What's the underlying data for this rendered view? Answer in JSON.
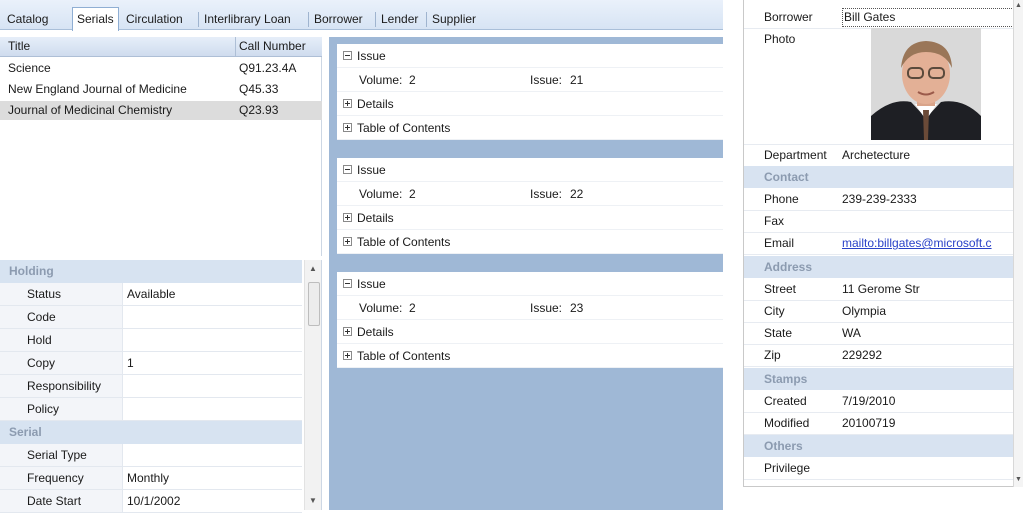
{
  "tabs": [
    {
      "label": "Catalog",
      "active": false
    },
    {
      "label": "Serials",
      "active": true
    },
    {
      "label": "Circulation",
      "active": false
    },
    {
      "label": "Interlibrary Loan",
      "active": false
    },
    {
      "label": "Borrower",
      "active": false
    },
    {
      "label": "Lender",
      "active": false
    },
    {
      "label": "Supplier",
      "active": false
    }
  ],
  "titles": {
    "headers": {
      "title": "Title",
      "call_number": "Call Number"
    },
    "rows": [
      {
        "title": "Science",
        "call_number": "Q91.23.4A"
      },
      {
        "title": "New England Journal of Medicine",
        "call_number": "Q45.33"
      },
      {
        "title": "Journal of Medicinal Chemistry",
        "call_number": "Q23.93",
        "selected": true
      }
    ]
  },
  "holding": {
    "sections": [
      {
        "label": "Holding",
        "rows": [
          {
            "key": "Status",
            "value": "Available"
          },
          {
            "key": "Code",
            "value": ""
          },
          {
            "key": "Hold",
            "value": ""
          },
          {
            "key": "Copy",
            "value": "1"
          },
          {
            "key": "Responsibility",
            "value": ""
          },
          {
            "key": "Policy",
            "value": ""
          }
        ]
      },
      {
        "label": "Serial",
        "rows": [
          {
            "key": "Serial Type",
            "value": ""
          },
          {
            "key": "Frequency",
            "value": "Monthly"
          },
          {
            "key": "Date Start",
            "value": "10/1/2002"
          }
        ]
      }
    ]
  },
  "issues": [
    {
      "header": "Issue",
      "volume_label": "Volume:",
      "volume": "2",
      "issue_label": "Issue:",
      "issue": "21",
      "details": "Details",
      "toc": "Table of Contents"
    },
    {
      "header": "Issue",
      "volume_label": "Volume:",
      "volume": "2",
      "issue_label": "Issue:",
      "issue": "22",
      "details": "Details",
      "toc": "Table of Contents"
    },
    {
      "header": "Issue",
      "volume_label": "Volume:",
      "volume": "2",
      "issue_label": "Issue:",
      "issue": "23",
      "details": "Details",
      "toc": "Table of Contents"
    }
  ],
  "borrower": {
    "name_label": "Borrower",
    "name": "Bill Gates",
    "photo_label": "Photo",
    "department_label": "Department",
    "department": "Archetecture",
    "contact_section": "Contact",
    "phone_label": "Phone",
    "phone": "239-239-2333",
    "fax_label": "Fax",
    "fax": "",
    "email_label": "Email",
    "email": "mailto:billgates@microsoft.c",
    "address_section": "Address",
    "street_label": "Street",
    "street": "11 Gerome Str",
    "city_label": "City",
    "city": "Olympia",
    "state_label": "State",
    "state": "WA",
    "zip_label": "Zip",
    "zip": "229292",
    "stamps_section": "Stamps",
    "created_label": "Created",
    "created": "7/19/2010",
    "modified_label": "Modified",
    "modified": "20100719",
    "others_section": "Others",
    "privilege_label": "Privilege",
    "privilege": ""
  }
}
